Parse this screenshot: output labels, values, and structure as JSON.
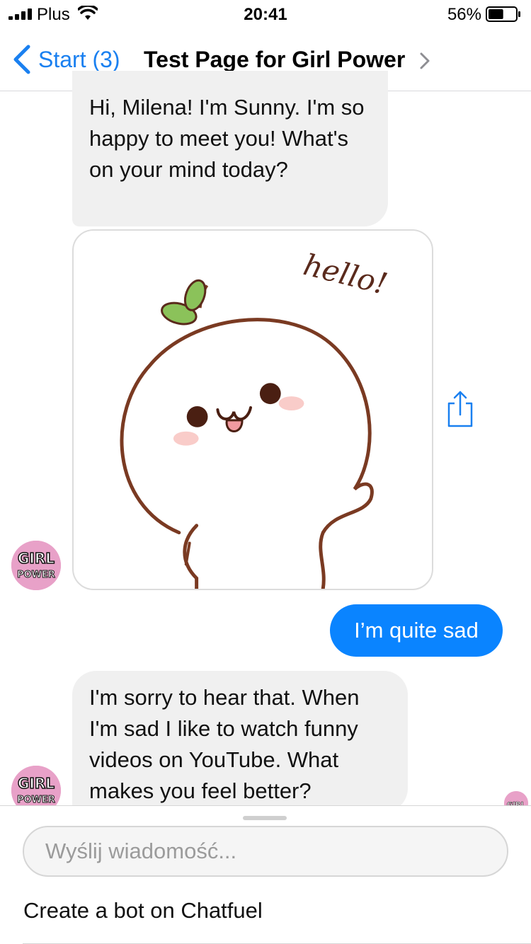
{
  "status_bar": {
    "carrier": "Plus",
    "time": "20:41",
    "battery_percent": "56%",
    "battery_level": 0.56,
    "icons": [
      "signal-icon",
      "wifi-icon",
      "battery-icon"
    ]
  },
  "nav": {
    "back_label": "Start (3)",
    "title": "Test Page for Girl Power",
    "icons": [
      "chevron-left-icon",
      "chevron-right-icon"
    ],
    "accent_color": "#1a80f0"
  },
  "messages": {
    "bot_greeting": "Hi, Milena! I'm Sunny. I'm so happy to meet you! What's on your mind today?",
    "sticker": {
      "text": "hello!",
      "icon": "sticker-image"
    },
    "user_reply": "I’m quite sad",
    "bot_reply": "I'm sorry to hear that. When I'm sad I like to watch funny videos on YouTube. What makes you feel better?",
    "user_bubble_color": "#0a84ff",
    "bot_bubble_color": "#f0f0f0"
  },
  "avatar": {
    "text_top": "GIRL",
    "text_bottom": "POWER",
    "color": "#e8a1c8"
  },
  "composer": {
    "placeholder": "Wyślij wiadomość...",
    "footer_link": "Create a bot on Chatfuel"
  }
}
